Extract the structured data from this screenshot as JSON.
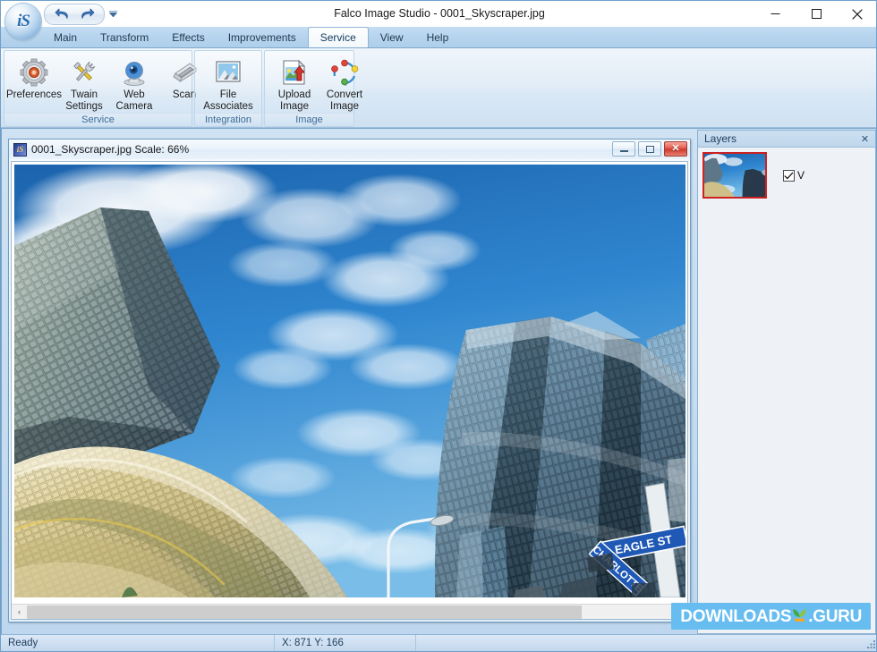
{
  "window": {
    "title": "Falco Image Studio - 0001_Skyscraper.jpg",
    "minimize_label": "Minimize",
    "maximize_label": "Maximize",
    "close_label": "Close"
  },
  "quick_access": {
    "undo_label": "Undo",
    "redo_label": "Redo",
    "customize_label": "Customize Quick Access Toolbar"
  },
  "logo": {
    "text": "iS"
  },
  "tabs": [
    {
      "label": "Main",
      "active": false
    },
    {
      "label": "Transform",
      "active": false
    },
    {
      "label": "Effects",
      "active": false
    },
    {
      "label": "Improvements",
      "active": false
    },
    {
      "label": "Service",
      "active": true
    },
    {
      "label": "View",
      "active": false
    },
    {
      "label": "Help",
      "active": false
    }
  ],
  "ribbon": {
    "groups": [
      {
        "label": "Service",
        "buttons": [
          {
            "label": "Preferences",
            "icon": "gear-icon"
          },
          {
            "label": "Twain\nSettings",
            "icon": "tools-icon"
          },
          {
            "label": "Web\nCamera",
            "icon": "webcam-icon"
          },
          {
            "label": "Scan",
            "icon": "scanner-icon"
          }
        ]
      },
      {
        "label": "Integration",
        "buttons": [
          {
            "label": "File\nAssociates",
            "icon": "picture-icon"
          }
        ]
      },
      {
        "label": "Image",
        "buttons": [
          {
            "label": "Upload\nImage",
            "icon": "upload-image-icon"
          },
          {
            "label": "Convert\nImage",
            "icon": "convert-image-icon"
          }
        ]
      }
    ]
  },
  "document": {
    "file_name": "0001_Skyscraper.jpg",
    "scale_label": "Scale: 66%",
    "title_full": "0001_Skyscraper.jpg  Scale: 66%",
    "minimize_label": "Minimize",
    "restore_label": "Restore",
    "close_label": "Close",
    "scroll_left_label": "‹",
    "scroll_right_label": "›"
  },
  "layers": {
    "title": "Layers",
    "close_label": "✕",
    "items": [
      {
        "name": "V",
        "visible": true
      }
    ]
  },
  "status": {
    "message": "Ready",
    "coordinates": "X: 871 Y: 166"
  },
  "watermark": {
    "part1": "DOWNLOADS",
    "part2": ".GURU"
  },
  "colors": {
    "accent": "#2b6fae",
    "ribbon_tab_strip": "#b7d4ee",
    "mdi_background": "#bed7ee",
    "status_bar": "#cfe0f2",
    "layer_selection": "#cc2222",
    "watermark_bg": "#67bdf0"
  }
}
